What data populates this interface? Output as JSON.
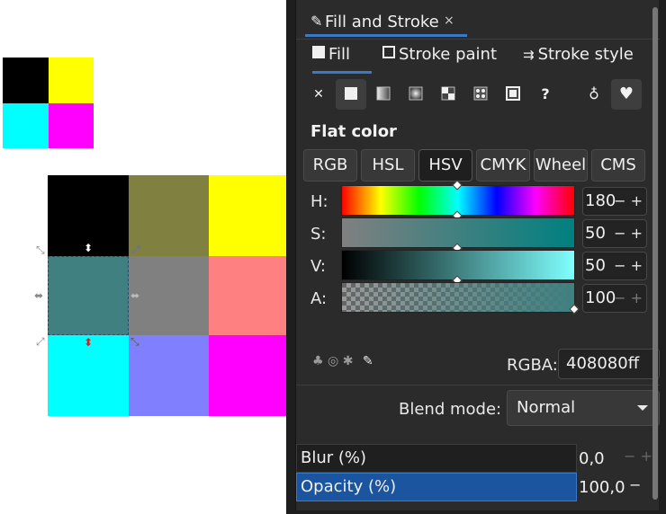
{
  "canvas": {
    "colors": {
      "black": "#000000",
      "yellow": "#ffff00",
      "cyan": "#00ffff",
      "magenta": "#ff00ff",
      "olive": "#808040",
      "teal": "#408080",
      "gray": "#808080",
      "salmon": "#ff8080",
      "periwinkle": "#8080ff"
    }
  },
  "panel": {
    "tab_title": "Fill and Stroke",
    "tab_close": "×",
    "subtabs": [
      "Fill",
      "Stroke paint",
      "Stroke style"
    ],
    "paint_types": [
      "no-paint",
      "flat-color",
      "linear-gradient",
      "radial-gradient",
      "pattern",
      "mesh-gradient",
      "swatch",
      "unset"
    ],
    "unset_label": "?",
    "flat_color_label": "Flat color",
    "modes": [
      "RGB",
      "HSL",
      "HSV",
      "CMYK",
      "Wheel",
      "CMS"
    ],
    "selected_mode": "HSV",
    "sliders": [
      {
        "label": "H:",
        "value": "180",
        "pm": "− +"
      },
      {
        "label": "S:",
        "value": "50",
        "pm": "− +"
      },
      {
        "label": "V:",
        "value": "50",
        "pm": "− +"
      },
      {
        "label": "A:",
        "value": "100",
        "pm": "− +"
      }
    ],
    "levels": {
      "h": 0.5,
      "s": 0.5,
      "v": 0.5,
      "a": 1.0
    },
    "rgba_label": "RGBA:",
    "rgba_value": "408080ff",
    "blend_label": "Blend mode:",
    "blend_value": "Normal",
    "blur_label": "Blur (%)",
    "blur_value": "0,0",
    "opacity_label": "Opacity (%)",
    "opacity_value": "100,0",
    "accent": "#3a79c6",
    "highlight": "#1b55a0"
  }
}
